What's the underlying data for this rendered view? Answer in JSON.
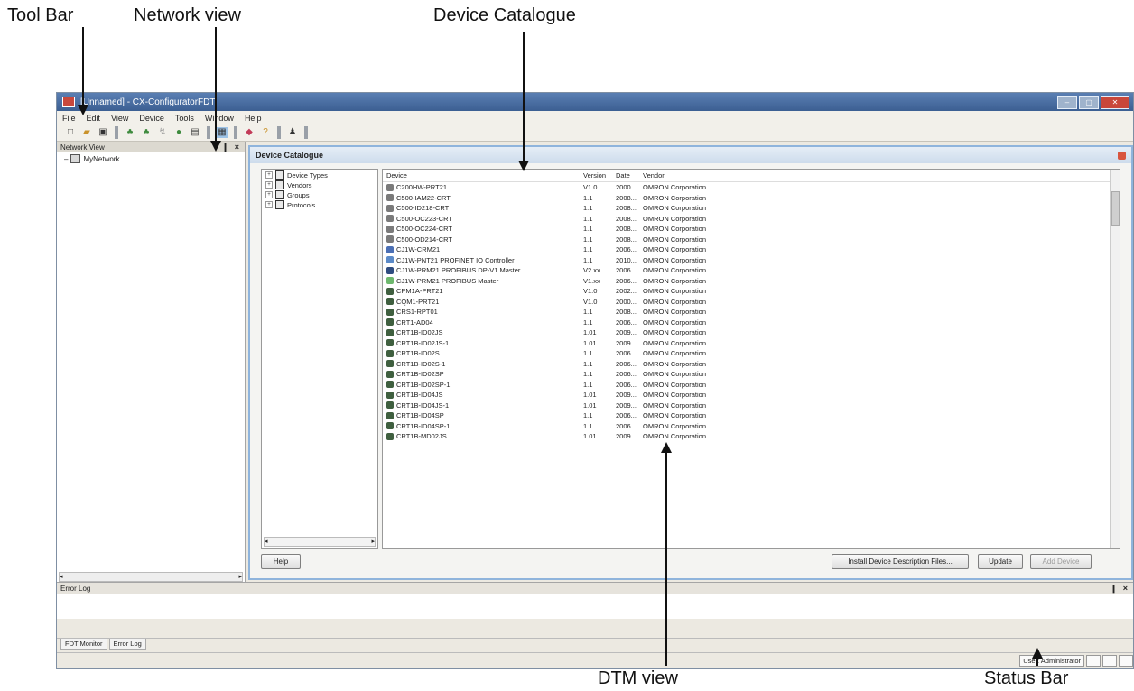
{
  "callouts": {
    "toolbar": "Tool Bar",
    "network_view": "Network view",
    "device_catalogue": "Device Catalogue",
    "dtm_view": "DTM view",
    "status_bar": "Status Bar"
  },
  "window": {
    "title": "[Unnamed] - CX-ConfiguratorFDT"
  },
  "menu": [
    "File",
    "Edit",
    "View",
    "Device",
    "Tools",
    "Window",
    "Help"
  ],
  "network_view": {
    "title": "Network View",
    "controls": "❙ ×",
    "root_item": "MyNetwork"
  },
  "catalogue": {
    "title": "Device Catalogue",
    "tree": [
      "Device Types",
      "Vendors",
      "Groups",
      "Protocols"
    ],
    "columns": {
      "device": "Device",
      "version": "Version",
      "date": "Date",
      "vendor": "Vendor"
    },
    "rows": [
      {
        "device": "C200HW-PRT21",
        "version": "V1.0",
        "date": "2000...",
        "vendor": "OMRON Corporation"
      },
      {
        "device": "C500-IAM22-CRT",
        "version": "1.1",
        "date": "2008...",
        "vendor": "OMRON Corporation"
      },
      {
        "device": "C500-ID218-CRT",
        "version": "1.1",
        "date": "2008...",
        "vendor": "OMRON Corporation"
      },
      {
        "device": "C500-OC223-CRT",
        "version": "1.1",
        "date": "2008...",
        "vendor": "OMRON Corporation"
      },
      {
        "device": "C500-OC224-CRT",
        "version": "1.1",
        "date": "2008...",
        "vendor": "OMRON Corporation"
      },
      {
        "device": "C500-OD214-CRT",
        "version": "1.1",
        "date": "2008...",
        "vendor": "OMRON Corporation"
      },
      {
        "device": "CJ1W-CRM21",
        "version": "1.1",
        "date": "2006...",
        "vendor": "OMRON Corporation"
      },
      {
        "device": "CJ1W-PNT21 PROFINET IO Controller",
        "version": "1.1",
        "date": "2010...",
        "vendor": "OMRON Corporation"
      },
      {
        "device": "CJ1W-PRM21 PROFIBUS DP-V1 Master",
        "version": "V2.xx",
        "date": "2006...",
        "vendor": "OMRON Corporation"
      },
      {
        "device": "CJ1W-PRM21 PROFIBUS Master",
        "version": "V1.xx",
        "date": "2006...",
        "vendor": "OMRON Corporation"
      },
      {
        "device": "CPM1A-PRT21",
        "version": "V1.0",
        "date": "2002...",
        "vendor": "OMRON Corporation"
      },
      {
        "device": "CQM1-PRT21",
        "version": "V1.0",
        "date": "2000...",
        "vendor": "OMRON Corporation"
      },
      {
        "device": "CRS1-RPT01",
        "version": "1.1",
        "date": "2008...",
        "vendor": "OMRON Corporation"
      },
      {
        "device": "CRT1-AD04",
        "version": "1.1",
        "date": "2006...",
        "vendor": "OMRON Corporation"
      },
      {
        "device": "CRT1B-ID02JS",
        "version": "1.01",
        "date": "2009...",
        "vendor": "OMRON Corporation"
      },
      {
        "device": "CRT1B-ID02JS-1",
        "version": "1.01",
        "date": "2009...",
        "vendor": "OMRON Corporation"
      },
      {
        "device": "CRT1B-ID02S",
        "version": "1.1",
        "date": "2006...",
        "vendor": "OMRON Corporation"
      },
      {
        "device": "CRT1B-ID02S-1",
        "version": "1.1",
        "date": "2006...",
        "vendor": "OMRON Corporation"
      },
      {
        "device": "CRT1B-ID02SP",
        "version": "1.1",
        "date": "2006...",
        "vendor": "OMRON Corporation"
      },
      {
        "device": "CRT1B-ID02SP-1",
        "version": "1.1",
        "date": "2006...",
        "vendor": "OMRON Corporation"
      },
      {
        "device": "CRT1B-ID04JS",
        "version": "1.01",
        "date": "2009...",
        "vendor": "OMRON Corporation"
      },
      {
        "device": "CRT1B-ID04JS-1",
        "version": "1.01",
        "date": "2009...",
        "vendor": "OMRON Corporation"
      },
      {
        "device": "CRT1B-ID04SP",
        "version": "1.1",
        "date": "2006...",
        "vendor": "OMRON Corporation"
      },
      {
        "device": "CRT1B-ID04SP-1",
        "version": "1.1",
        "date": "2006...",
        "vendor": "OMRON Corporation"
      },
      {
        "device": "CRT1B-MD02JS",
        "version": "1.01",
        "date": "2009...",
        "vendor": "OMRON Corporation"
      }
    ],
    "buttons": {
      "help": "Help",
      "install": "Install Device Description Files...",
      "update": "Update",
      "add": "Add Device"
    }
  },
  "error_log": {
    "title": "Error Log",
    "controls": "❙ ×"
  },
  "tabs": [
    "FDT Monitor",
    "Error Log"
  ],
  "status_bar": {
    "user": "User: Administrator"
  },
  "colors": {
    "title_bar": "#3c5f92",
    "catalogue_border": "#8fb4dc",
    "close": "#c9473a"
  }
}
